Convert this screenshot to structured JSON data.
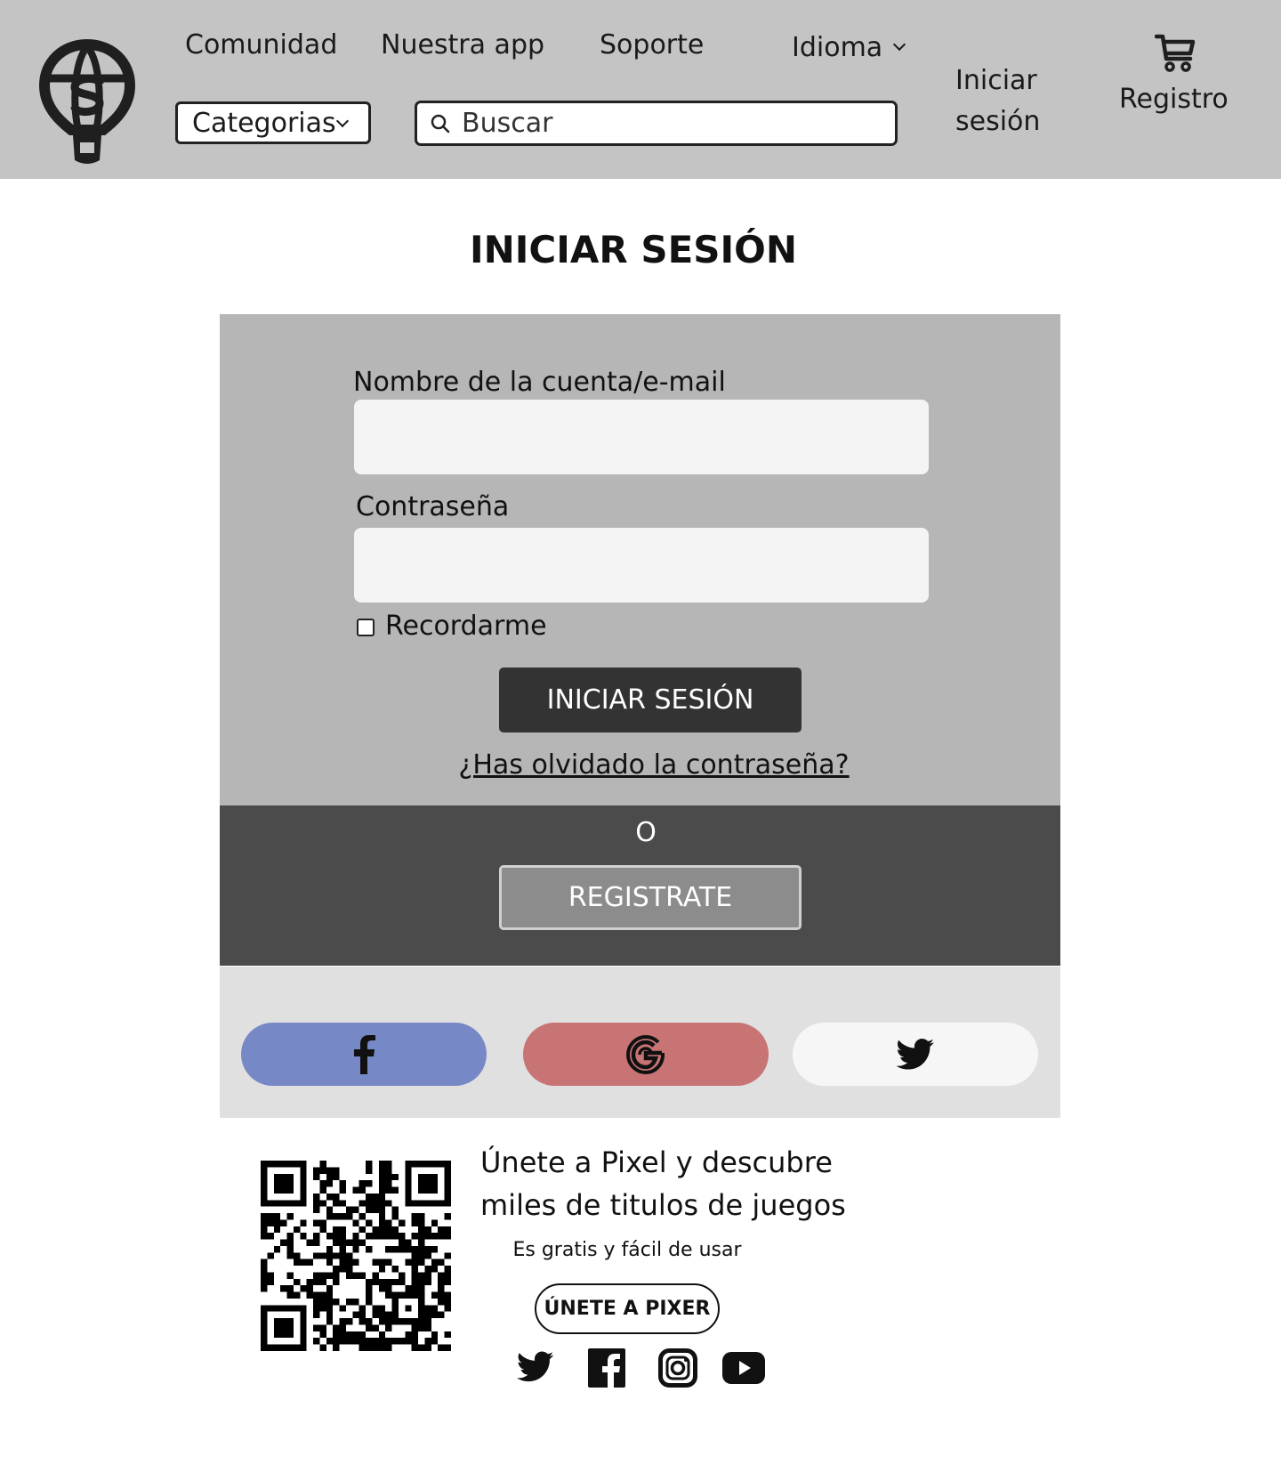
{
  "header": {
    "nav": [
      "Comunidad",
      "Nuestra app",
      "Soporte"
    ],
    "language_label": "Idioma",
    "categories_label": "Categorias",
    "search_placeholder": "Buscar",
    "login_line1": "Iniciar",
    "login_line2": "sesión",
    "register_label": "Registro"
  },
  "page": {
    "title": "INICIAR SESIÓN"
  },
  "login_form": {
    "account_label": "Nombre de la cuenta/e-mail",
    "account_value": "",
    "password_label": "Contraseña",
    "password_value": "",
    "remember_label": "Recordarme",
    "remember_checked": false,
    "submit_label": "INICIAR SESIÓN",
    "forgot_label": "¿Has olvidado la contraseña?"
  },
  "register": {
    "or_text": "O",
    "button_label": "REGISTRATE"
  },
  "social_login": [
    {
      "icon": "facebook-icon",
      "color": "#7788c6"
    },
    {
      "icon": "google-icon",
      "color": "#c87474"
    },
    {
      "icon": "twitter-icon",
      "color": "#f6f6f6"
    }
  ],
  "footer": {
    "promo_line1": "Únete a Pixel y descubre",
    "promo_line2": "miles de titulos de juegos",
    "promo_sub": "Es gratis y fácil de usar",
    "join_label": "ÚNETE A PIXER",
    "social_icons": [
      "twitter-icon",
      "facebook-icon",
      "instagram-icon",
      "youtube-icon"
    ]
  },
  "colors": {
    "header_bg": "#c4c4c4",
    "card_bg": "#b6b6b6",
    "register_band_bg": "#4b4b4b",
    "social_band_bg": "#e0e0e0",
    "primary_button": "#333333",
    "secondary_button": "#8c8c8c"
  }
}
